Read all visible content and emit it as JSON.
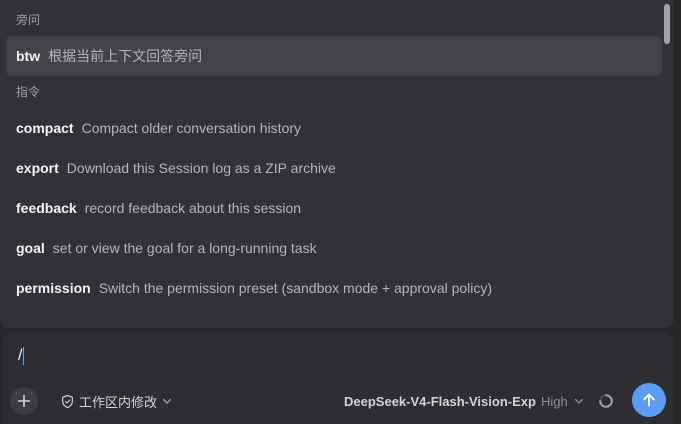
{
  "popup": {
    "sections": [
      {
        "header": "旁问",
        "items": [
          {
            "name": "btw",
            "description": "根据当前上下文回答旁问"
          }
        ]
      },
      {
        "header": "指令",
        "items": [
          {
            "name": "compact",
            "description": "Compact older conversation history"
          },
          {
            "name": "export",
            "description": "Download this Session log as a ZIP archive"
          },
          {
            "name": "feedback",
            "description": "record feedback about this session"
          },
          {
            "name": "goal",
            "description": "set or view the goal for a long-running task"
          },
          {
            "name": "permission",
            "description": "Switch the permission preset (sandbox mode + approval policy)"
          }
        ]
      }
    ]
  },
  "composer": {
    "input_value": "/",
    "permission_label": "工作区内修改",
    "model_name": "DeepSeek-V4-Flash-Vision-Exp",
    "model_effort": "High"
  },
  "icons": {
    "add": "plus-icon",
    "permission": "shield-icon",
    "dropdown": "chevron-down-icon",
    "loading": "spinner-icon",
    "send": "arrow-up-icon"
  },
  "colors": {
    "background": "#27272a",
    "popup": "#323236",
    "selected": "#434347",
    "accent": "#5b9cf5"
  }
}
